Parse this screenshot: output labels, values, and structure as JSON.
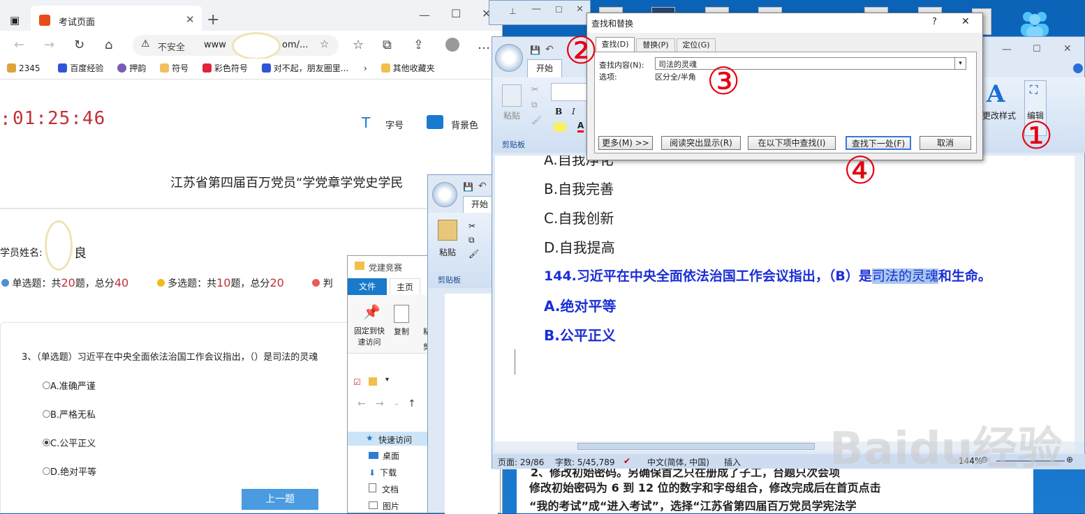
{
  "browser": {
    "tab_title": "考试页面",
    "insecure": "不安全",
    "url_prefix": "www",
    "url_suffix": "om/...",
    "favs": [
      "2345",
      "百度经验",
      "押韵",
      "符号",
      "彩色符号",
      "对不起，朋友圈里...",
      "其他收藏夹"
    ],
    "timer": "01:25:46",
    "timer_prefix": ":",
    "font_size_label": "字号",
    "bg_label": "背景色",
    "exam_title": "江苏省第四届百万党员“学党章学党史学民",
    "student_label": "学员姓名:",
    "student_name_end": "良",
    "stats": [
      {
        "label": "单选题：共",
        "count": "20",
        "mid": "题，总分",
        "score": "40",
        "color": "#4a90d9"
      },
      {
        "label": "多选题：共",
        "count": "10",
        "mid": "题，总分",
        "score": "20",
        "color": "#f5b81c"
      },
      {
        "label": "判",
        "color": "#e85b5b"
      }
    ],
    "question": "3、（单选题）习近平在中央全面依法治国工作会议指出，（）是司法的灵魂",
    "options": [
      "A.准确严谨",
      "B.严格无私",
      "C.公平正义",
      "D.绝对平等"
    ],
    "selected_option": 2,
    "prev_button": "上一题"
  },
  "explorer": {
    "title": "党建竞赛",
    "tabs": [
      "文件",
      "主页"
    ],
    "pin_label": "固定到快速访问",
    "copy_label": "复制",
    "paste_frag": "粘",
    "cut_frag": "剪",
    "nav": [
      "快速访问",
      "桌面",
      "下载",
      "文档",
      "图片"
    ]
  },
  "word_back": {
    "tab": "开始",
    "paste": "粘贴",
    "clipboard": "剪贴板"
  },
  "word_front": {
    "tab": "开始",
    "paste": "粘贴",
    "clipboard": "剪贴板",
    "change_style": "更改样式",
    "edit": "编辑",
    "lines": [
      {
        "text": "A.自我净化",
        "color": "#222",
        "bold": false
      },
      {
        "text": "B.自我完善",
        "color": "#222",
        "bold": false
      },
      {
        "text": "C.自我创新",
        "color": "#222",
        "bold": false
      },
      {
        "text": "D.自我提高",
        "color": "#222",
        "bold": false
      }
    ],
    "q_before": "144.习近平在中央全面依法治国工作会议指出，（B）是",
    "q_highlight": "司法的灵魂",
    "q_after": "和生命。",
    "answers": [
      "A.绝对平等",
      "B.公平正义"
    ],
    "status": {
      "page": "页面: 29/86",
      "words": "字数: 5/45,789",
      "lang": "中文(简体, 中国)",
      "mode": "插入",
      "zoom": "144%"
    },
    "below_text": [
      "2、修改初始密码。另确保首之只在册成了子工，台题只次会项",
      "修改初始密码为 6 到 12 位的数字和字母组合，修改完成后在首页点击",
      "“我的考试”成“进入考试”，选择“江苏省第四届百万党员学宪法学"
    ]
  },
  "dialog": {
    "title": "查找和替换",
    "help": "?",
    "tabs": [
      "查找(D)",
      "替换(P)",
      "定位(G)"
    ],
    "find_label": "查找内容(N):",
    "find_value": "司法的灵魂",
    "options_label": "选项:",
    "options_value": "区分全/半角",
    "buttons": [
      "更多(M) >>",
      "阅读突出显示(R)",
      "在以下项中查找(I)",
      "查找下一处(F)",
      "取消"
    ]
  },
  "annotations": [
    "①",
    "②",
    "③",
    "④"
  ],
  "watermark": "Baidu经验",
  "accent": "#e60012"
}
